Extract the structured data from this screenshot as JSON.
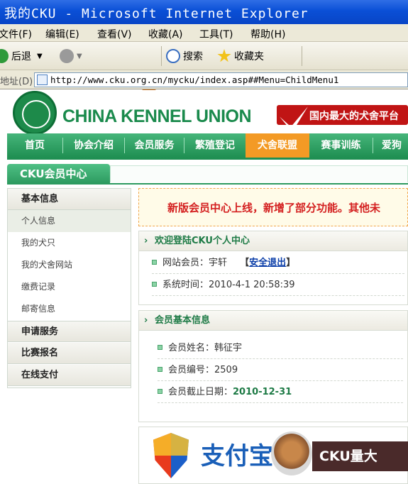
{
  "window": {
    "title": "我的CKU - Microsoft Internet Explorer"
  },
  "menu": [
    "文件(F)",
    "编辑(E)",
    "查看(V)",
    "收藏(A)",
    "工具(T)",
    "帮助(H)"
  ],
  "toolbar": {
    "back": "后退",
    "search": "搜索",
    "favorites": "收藏夹"
  },
  "address": {
    "label": "地址(D)",
    "url": "http://www.cku.org.cn/mycku/index.asp##Menu=ChildMenu1"
  },
  "site": {
    "brand": "CHINA KENNEL UNION",
    "banner": "国内最大的犬舍平台",
    "nav": [
      "首页",
      "协会介绍",
      "会员服务",
      "繁殖登记",
      "犬舍联盟",
      "赛事训练",
      "爱狗"
    ],
    "active_nav": "犬舍联盟",
    "center_title": "CKU会员中心"
  },
  "sidebar": {
    "sections": [
      {
        "title": "基本信息",
        "items": [
          "个人信息",
          "我的犬只",
          "我的犬舍网站",
          "缴费记录",
          "邮寄信息"
        ]
      },
      {
        "title": "申请服务",
        "items": []
      },
      {
        "title": "比赛报名",
        "items": []
      },
      {
        "title": "在线支付",
        "items": []
      }
    ],
    "selected": "个人信息"
  },
  "notice": "新版会员中心上线，新增了部分功能。其他未",
  "welcome": {
    "title": "欢迎登陆CKU个人中心",
    "member_label": "网站会员：宇轩",
    "logout_open": "【",
    "logout": "安全退出",
    "logout_close": "】",
    "time_label": "系统时间：",
    "time": "2010-4-1 20:58:39"
  },
  "member_info": {
    "title": "会员基本信息",
    "name_label": "会员姓名：",
    "name": "韩征宇",
    "number_label": "会员编号：",
    "number": "2509",
    "expiry_label": "会员截止日期：",
    "expiry": "2010-12-31"
  },
  "bottom": {
    "alipay": "支付宝",
    "cku": "CKU量大"
  }
}
